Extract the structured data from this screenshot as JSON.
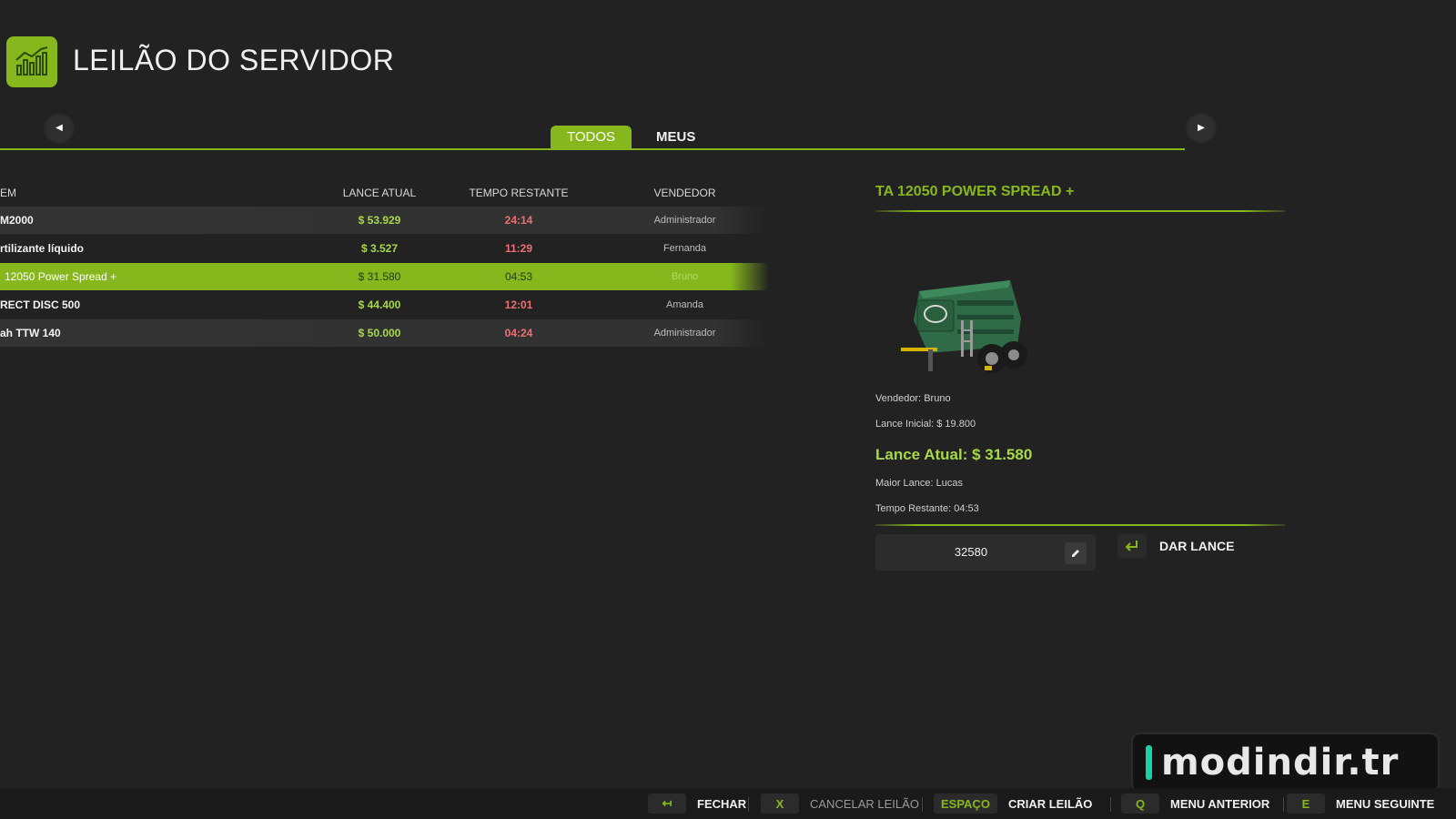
{
  "header": {
    "title": "LEILÃO DO SERVIDOR",
    "icon": "bar-chart-icon"
  },
  "tabs": [
    {
      "label": "TODOS",
      "active": true
    },
    {
      "label": "MEUS",
      "active": false
    }
  ],
  "table": {
    "columns": {
      "item": "EM",
      "bid": "LANCE ATUAL",
      "time": "TEMPO RESTANTE",
      "seller": "VENDEDOR"
    },
    "rows": [
      {
        "item": "M2000",
        "bid": "$ 53.929",
        "time": "24:14",
        "seller": "Administrador"
      },
      {
        "item": "rtilizante líquido",
        "bid": "$ 3.527",
        "time": "11:29",
        "seller": "Fernanda"
      },
      {
        "item": "12050 Power Spread +",
        "bid": "$ 31.580",
        "time": "04:53",
        "seller": "Bruno",
        "selected": true
      },
      {
        "item": "RECT DISC 500",
        "bid": "$ 44.400",
        "time": "12:01",
        "seller": "Amanda"
      },
      {
        "item": "ah TTW 140",
        "bid": "$ 50.000",
        "time": "04:24",
        "seller": "Administrador"
      }
    ]
  },
  "detail": {
    "title": "TA 12050 POWER SPREAD +",
    "seller": "Vendedor: Bruno",
    "start_bid": "Lance Inicial: $ 19.800",
    "current_bid": "Lance Atual: $ 31.580",
    "highest_bidder": "Maior Lance: Lucas",
    "time_left": "Tempo Restante: 04:53",
    "bid_input": "32580",
    "bid_button": "DAR LANCE"
  },
  "footer": {
    "close": {
      "key": "↤",
      "label": "FECHAR"
    },
    "cancel": {
      "key": "X",
      "label": "CANCELAR LEILÃO"
    },
    "create": {
      "key": "ESPAÇO",
      "label": "CRIAR LEILÃO"
    },
    "prev": {
      "key": "Q",
      "label": "MENU ANTERIOR"
    },
    "next": {
      "key": "E",
      "label": "MENU SEGUINTE"
    }
  },
  "watermark": {
    "text": "modindir.tr"
  },
  "colors": {
    "accent": "#86b81d",
    "money": "#a6d84a",
    "timer": "#ef6f6f",
    "background": "#222222"
  }
}
